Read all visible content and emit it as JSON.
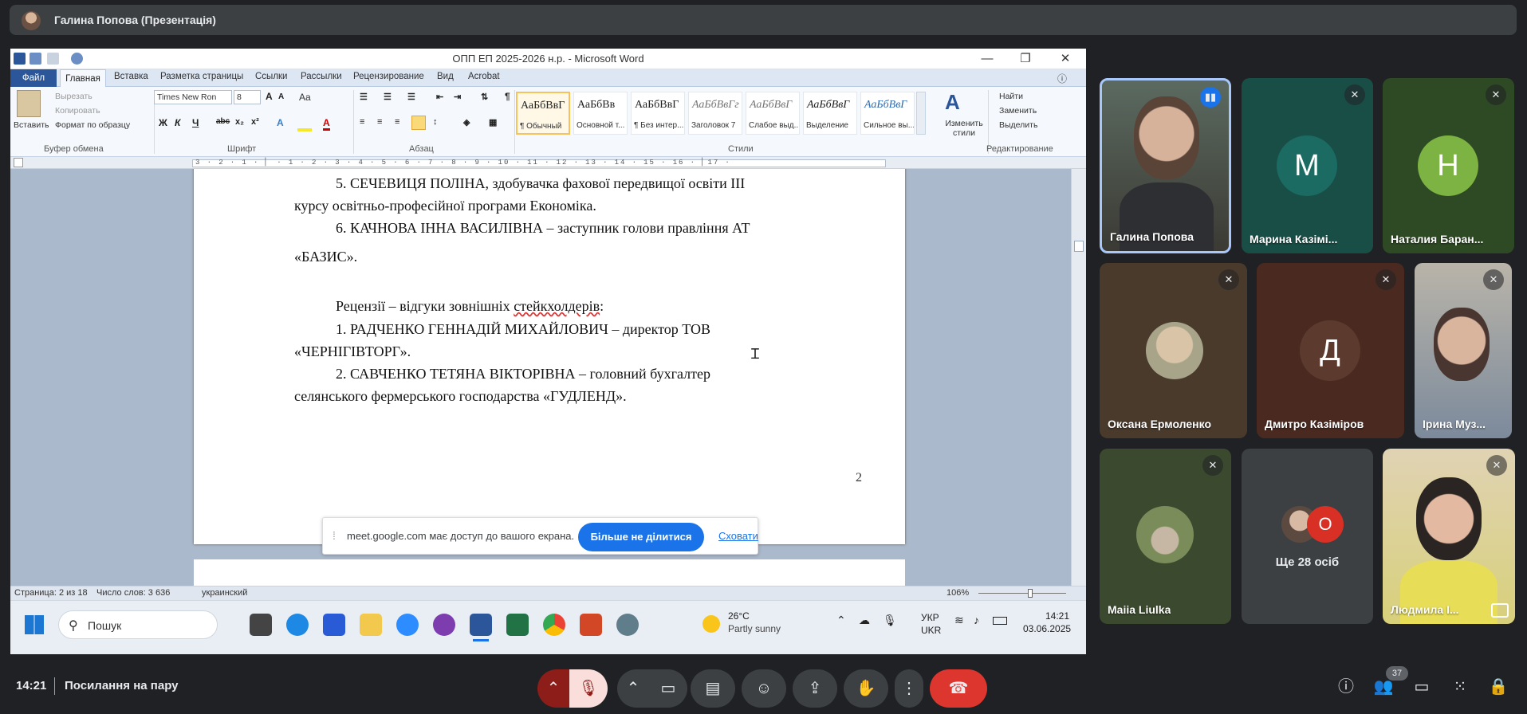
{
  "presenter_bar": {
    "name": "Галина Попова (Презентація)"
  },
  "word": {
    "title": "ОПП ЕП 2025-2026 н.р. - Microsoft Word",
    "tabs": [
      "Файл",
      "Главная",
      "Вставка",
      "Разметка страницы",
      "Ссылки",
      "Рассылки",
      "Рецензирование",
      "Вид",
      "Acrobat"
    ],
    "clipboard": {
      "paste": "Вставить",
      "cut": "Вырезать",
      "copy": "Копировать",
      "format_painter": "Формат по образцу",
      "group": "Буфер обмена"
    },
    "font": {
      "name": "Times New Ron",
      "size": "8",
      "group": "Шрифт",
      "case": "Aa"
    },
    "paragraph_group": "Абзац",
    "styles_group": "Стили",
    "styles": [
      {
        "sample": "АаБбВвГ",
        "label": "¶ Обычный"
      },
      {
        "sample": "АаБбВв",
        "label": "Основной т..."
      },
      {
        "sample": "АаБбВвГ",
        "label": "¶ Без интер..."
      },
      {
        "sample": "АаБбВвГг",
        "label": "Заголовок 7"
      },
      {
        "sample": "АаБбВвГ",
        "label": "Слабое выд..."
      },
      {
        "sample": "АаБбВвГ",
        "label": "Выделение"
      },
      {
        "sample": "АаБбВвГ",
        "label": "Сильное вы..."
      }
    ],
    "change_styles": "Изменить стили",
    "editing": {
      "find": "Найти",
      "replace": "Заменить",
      "select": "Выделить",
      "group": "Редактирование"
    },
    "ruler_ticks": "3 · 2 · 1 · ▏ · 1 · 2 · 3 · 4 · 5 · 6 · 7 · 8 · 9 · 10 · 11 · 12 · 13 · 14 · 15 · 16 · ▏17 ·",
    "document": {
      "line1": "5. СЕЧЕВИЦЯ ПОЛІНА, здобувачка фахової передвищої освіти ІІІ",
      "line2": "курсу освітньо-професійної програми Економіка.",
      "line3": "6. КАЧНОВА ІННА ВАСИЛІВНА – заступник голови правління АТ",
      "line4": "«БАЗИС».",
      "line5_pre": "Рецензії – відгуки зовнішніх ",
      "line5_err": "стейкхолдерів",
      "line5_post": ":",
      "line6": "1. РАДЧЕНКО ГЕННАДІЙ МИХАЙЛОВИЧ – директор ТОВ",
      "line7": "«ЧЕРНІГІВТОРГ».",
      "line8": "2. САВЧЕНКО ТЕТЯНА ВІКТОРІВНА  – головний бухгалтер",
      "line9": "селянського фермерського господарства «ГУДЛЕНД».",
      "page_number": "2"
    },
    "status": {
      "page": "Страница: 2 из 18",
      "words": "Число слов: 3 636",
      "lang": "украинский",
      "zoom": "106%"
    }
  },
  "share_notice": {
    "message": "meet.google.com має доступ до вашого екрана.",
    "stop": "Більше не ділитися",
    "hide": "Сховати"
  },
  "taskbar": {
    "search": "Пошук",
    "weather_temp": "26°C",
    "weather_desc": "Partly sunny",
    "lang1": "УКР",
    "lang2": "UKR",
    "time": "14:21",
    "date": "03.06.2025"
  },
  "participants": [
    {
      "name": "Галина Попова",
      "type": "video"
    },
    {
      "name": "Марина Казімі...",
      "letter": "M",
      "color": "#1b6b63"
    },
    {
      "name": "Наталия Баран...",
      "letter": "Н",
      "color": "#7cb342"
    },
    {
      "name": "Оксана Ермоленко",
      "type": "photo"
    },
    {
      "name": "Дмитро Казіміров",
      "letter": "Д",
      "color": "#5d3a2e"
    },
    {
      "name": "Ірина Муз...",
      "type": "video"
    },
    {
      "name": "Maiia Liulka",
      "type": "photo"
    },
    {
      "name": "Ще 28 осіб",
      "letter": "O",
      "color": "#d93025"
    },
    {
      "name": "Людмила І...",
      "type": "video"
    }
  ],
  "meeting": {
    "time": "14:21",
    "title": "Посилання на пару",
    "people_count": "37"
  }
}
